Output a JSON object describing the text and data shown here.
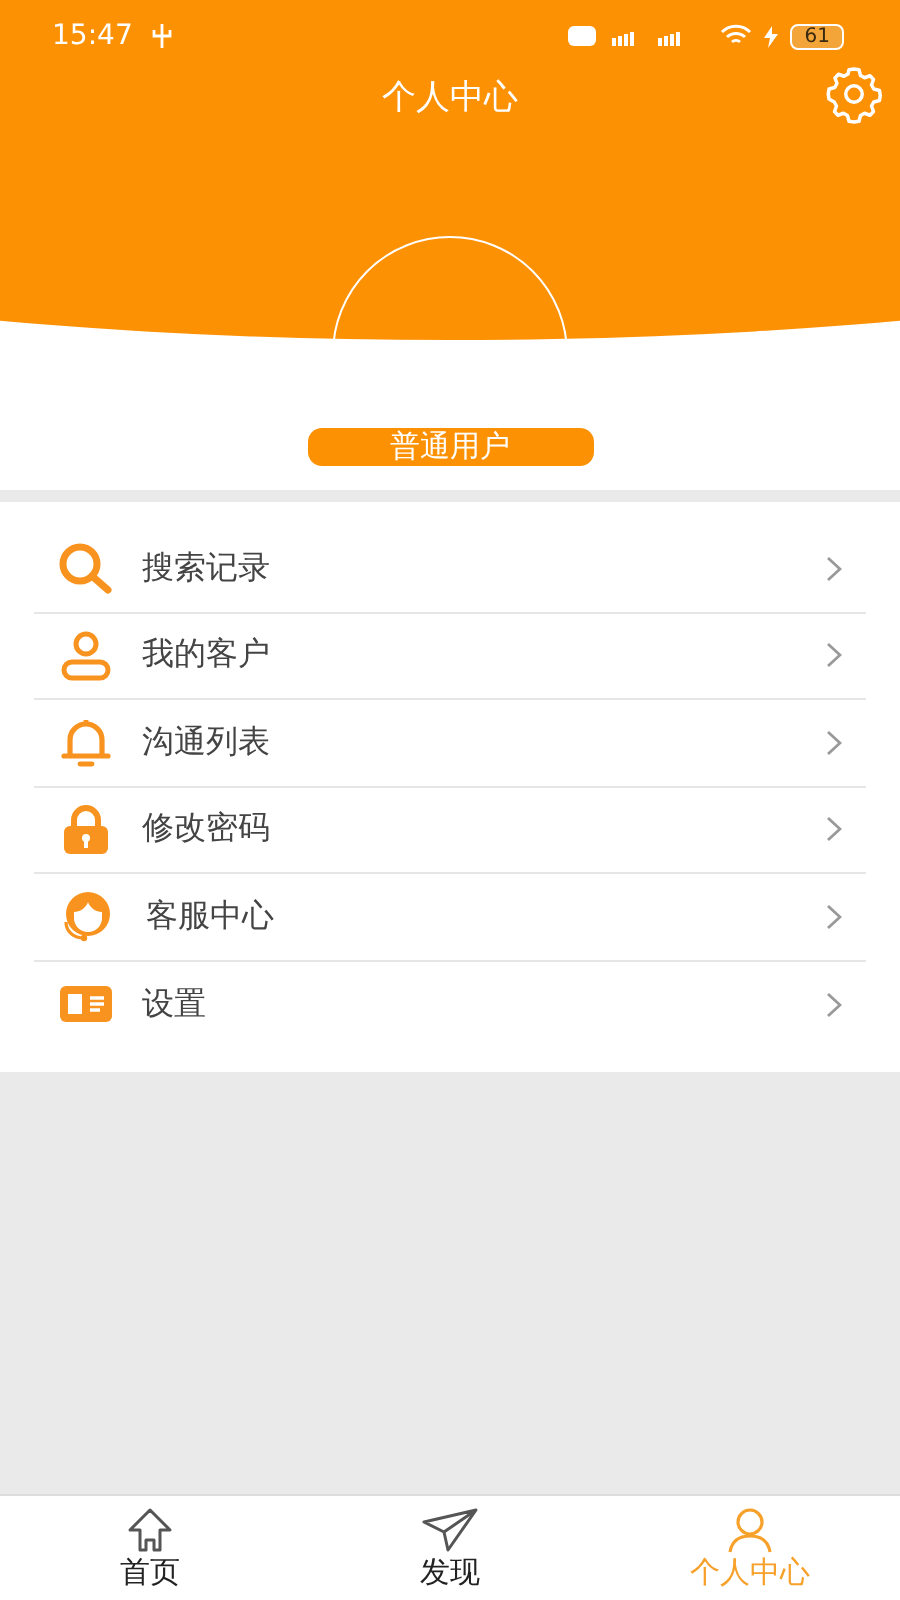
{
  "status_bar": {
    "time": "15:47",
    "battery": "61"
  },
  "header": {
    "title": "个人中心"
  },
  "profile": {
    "user_type": "普通用户"
  },
  "menu": [
    {
      "label": "搜索记录",
      "kind": "search"
    },
    {
      "label": "我的客户",
      "kind": "person"
    },
    {
      "label": "沟通列表",
      "kind": "bell"
    },
    {
      "label": "修改密码",
      "kind": "lock"
    },
    {
      "label": "客服中心",
      "kind": "headset"
    },
    {
      "label": "设置",
      "kind": "book"
    }
  ],
  "tabs": [
    {
      "label": "首页",
      "kind": "home",
      "selected": false
    },
    {
      "label": "发现",
      "kind": "plane",
      "selected": false
    },
    {
      "label": "个人中心",
      "kind": "person",
      "selected": true
    }
  ]
}
